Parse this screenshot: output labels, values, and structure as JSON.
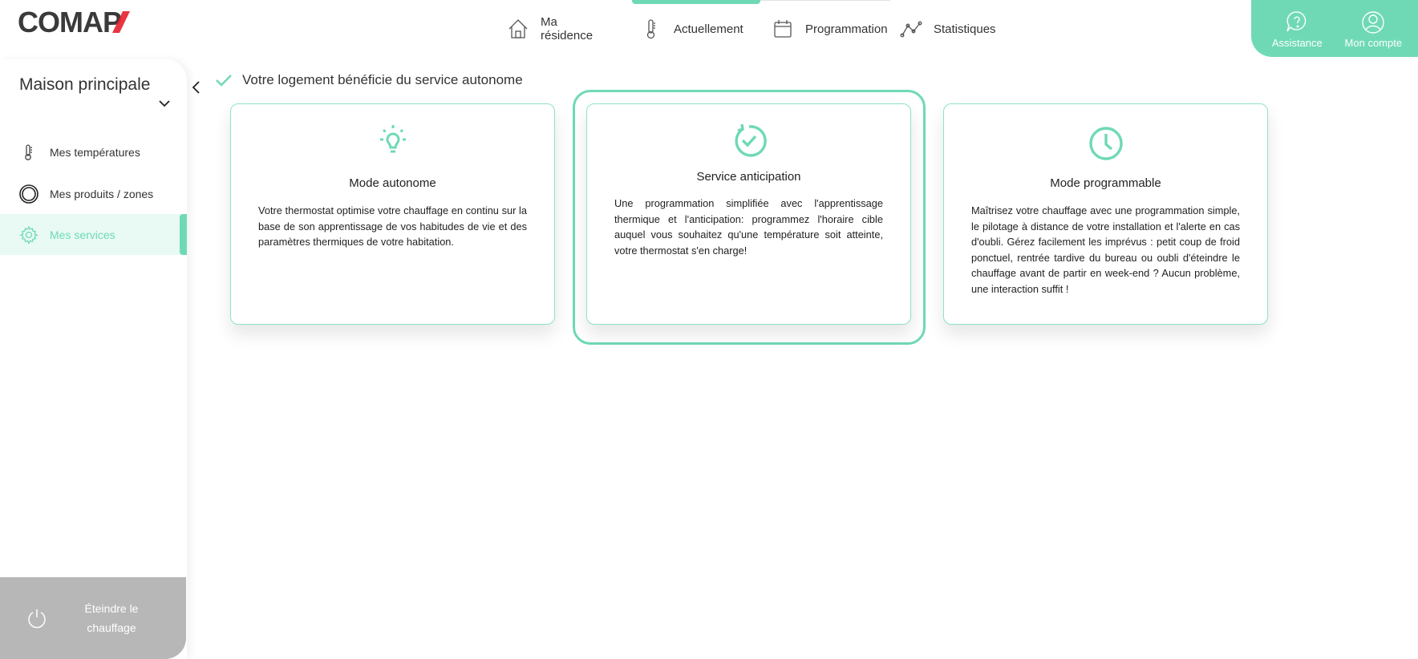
{
  "header": {
    "logo_text": "COMAP",
    "nav": [
      {
        "label": "Ma résidence",
        "icon": "house-icon"
      },
      {
        "label": "Actuellement",
        "icon": "thermometer-icon"
      },
      {
        "label": "Programmation",
        "icon": "calendar-icon"
      },
      {
        "label": "Statistiques",
        "icon": "chart-line-icon"
      }
    ],
    "account": [
      {
        "label": "Assistance",
        "icon": "help-bubble-icon"
      },
      {
        "label": "Mon compte",
        "icon": "user-icon"
      }
    ]
  },
  "sidebar": {
    "home_title": "Maison principale",
    "items": [
      {
        "label": "Mes températures",
        "icon": "thermometer-icon"
      },
      {
        "label": "Mes produits / zones",
        "icon": "ring-icon"
      },
      {
        "label": "Mes services",
        "icon": "gear-icon",
        "active": true
      }
    ],
    "power_label": "Éteindre le chauffage"
  },
  "main": {
    "banner": "Votre logement bénéficie du service autonome",
    "cards": [
      {
        "title": "Mode autonome",
        "icon": "lightbulb-icon",
        "description": "Votre thermostat optimise votre chauffage en continu sur la base de son apprentissage de vos habitudes de vie et des paramètres thermiques de votre habitation."
      },
      {
        "title": "Service anticipation",
        "icon": "refresh-check-icon",
        "selected": true,
        "description": "Une programmation simplifiée avec l'apprentissage thermique et l'anticipation: programmez l'horaire cible auquel vous souhaitez qu'une température soit atteinte, votre thermostat s'en charge!"
      },
      {
        "title": "Mode programmable",
        "icon": "clock-icon",
        "description": "Maîtrisez votre chauffage avec une programmation simple, le pilotage à distance de votre installation et l'alerte en cas d'oubli. Gérez facilement les imprévus : petit coup de froid ponctuel, rentrée tardive du bureau ou oubli d'éteindre le chauffage avant de partir en week-end ? Aucun problème, une interaction suffit !"
      }
    ]
  },
  "colors": {
    "accent": "#6fd9b6",
    "accent_light": "#e8faf3",
    "power_bg": "#b7b7b7",
    "logo_dark": "#3a3a3a",
    "logo_red": "#e5202e"
  }
}
